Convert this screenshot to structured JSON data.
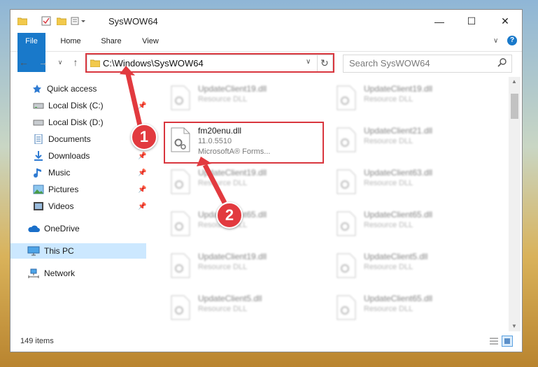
{
  "window": {
    "title": "SysWOW64",
    "controls": {
      "minimize": "—",
      "maximize": "☐",
      "close": "✕"
    }
  },
  "ribbon": {
    "tabs": [
      "File",
      "Home",
      "Share",
      "View"
    ],
    "expand_icon": "chevron-down-icon",
    "help_icon": "help-icon"
  },
  "address_bar": {
    "path": "C:\\Windows\\SysWOW64",
    "refresh_icon": "refresh-icon"
  },
  "search": {
    "placeholder": "Search SysWOW64"
  },
  "nav_pane": {
    "items": [
      {
        "label": "Quick access",
        "icon": "star-icon",
        "pinned": false
      },
      {
        "label": "Local Disk (C:)",
        "icon": "drive-icon",
        "pinned": true
      },
      {
        "label": "Local Disk (D:)",
        "icon": "drive-icon",
        "pinned": false
      },
      {
        "label": "Documents",
        "icon": "documents-icon",
        "pinned": true
      },
      {
        "label": "Downloads",
        "icon": "download-icon",
        "pinned": true
      },
      {
        "label": "Music",
        "icon": "music-icon",
        "pinned": true
      },
      {
        "label": "Pictures",
        "icon": "pictures-icon",
        "pinned": true
      },
      {
        "label": "Videos",
        "icon": "videos-icon",
        "pinned": true
      },
      {
        "label": "OneDrive",
        "icon": "cloud-icon",
        "pinned": false
      },
      {
        "label": "This PC",
        "icon": "computer-icon",
        "pinned": false,
        "selected": true
      },
      {
        "label": "Network",
        "icon": "network-icon",
        "pinned": false
      }
    ]
  },
  "files": {
    "left": [
      {
        "name": "UpdateClient19.dll",
        "line2": "Resource DLL",
        "line3": ""
      },
      {
        "name": "fm20enu.dll",
        "line2": "11.0.5510",
        "line3": "MicrosoftA® Forms...",
        "highlighted": true
      },
      {
        "name": "UpdateClient19.dll",
        "line2": "Resource DLL",
        "line3": ""
      },
      {
        "name": "UpdateClient65.dll",
        "line2": "Resource DLL",
        "line3": ""
      },
      {
        "name": "UpdateClient19.dll",
        "line2": "Resource DLL",
        "line3": ""
      },
      {
        "name": "UpdateClient5.dll",
        "line2": "Resource DLL",
        "line3": ""
      }
    ],
    "right": [
      {
        "name": "UpdateClient19.dll",
        "line2": "Resource DLL"
      },
      {
        "name": "UpdateClient21.dll",
        "line2": "Resource DLL"
      },
      {
        "name": "UpdateClient63.dll",
        "line2": "Resource DLL"
      },
      {
        "name": "UpdateClient65.dll",
        "line2": "Resource DLL"
      },
      {
        "name": "UpdateClient5.dll",
        "line2": "Resource DLL"
      },
      {
        "name": "UpdateClient65.dll",
        "line2": "Resource DLL"
      }
    ]
  },
  "status_bar": {
    "item_count": "149 items"
  },
  "callouts": [
    "1",
    "2"
  ],
  "colors": {
    "accent": "#1979ca",
    "highlight": "#d9363e",
    "selected_bg": "#cce8ff"
  }
}
